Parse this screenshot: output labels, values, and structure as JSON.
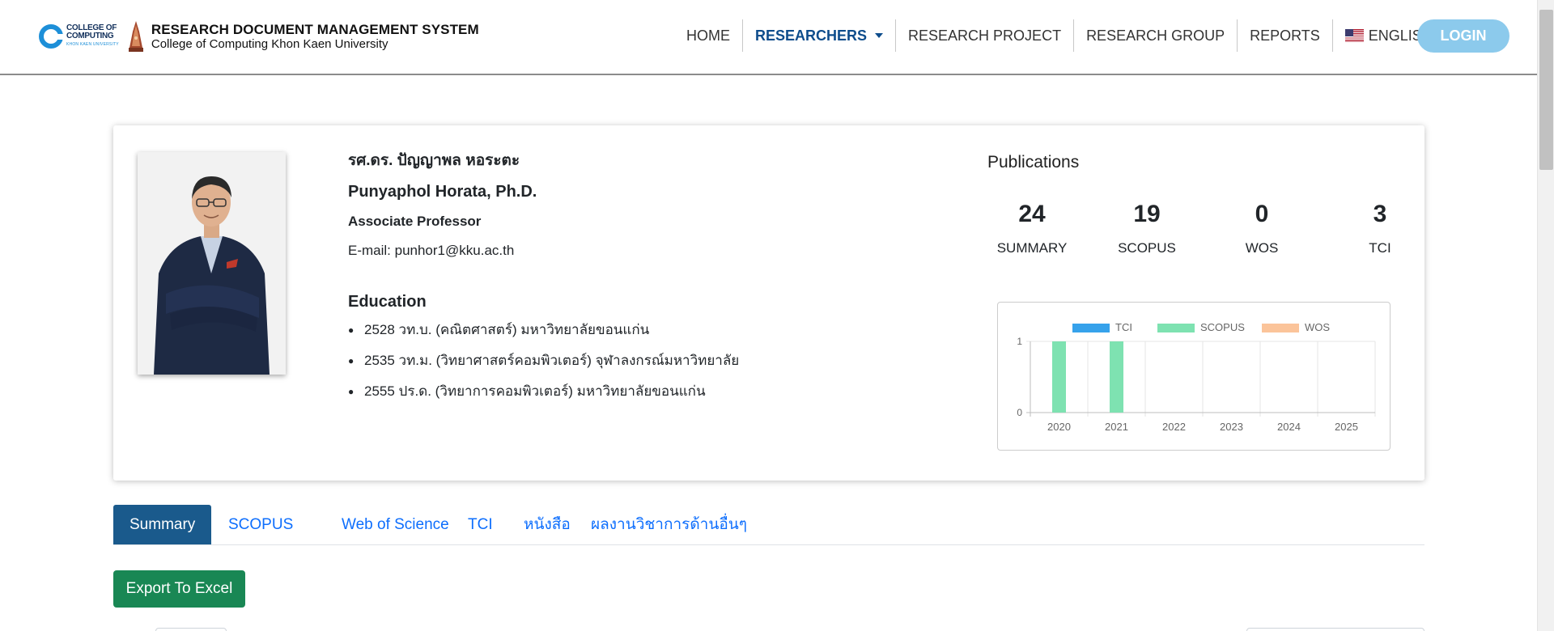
{
  "brand": {
    "logo_line1": "COLLEGE OF",
    "logo_line2": "COMPUTING",
    "logo_line3": "KHON KAEN UNIVERSITY",
    "title": "RESEARCH DOCUMENT MANAGEMENT SYSTEM",
    "subtitle": "College of Computing Khon Kaen University"
  },
  "nav": {
    "home": "HOME",
    "researchers": "RESEARCHERS",
    "research_project": "RESEARCH PROJECT",
    "research_group": "RESEARCH GROUP",
    "reports": "REPORTS",
    "language": "ENGLISH",
    "login": "LOGIN"
  },
  "profile": {
    "name_th": "รศ.ดร. ปัญญาพล หอระตะ",
    "name_en": "Punyaphol Horata, Ph.D.",
    "position": "Associate Professor",
    "email": "E-mail: punhor1@kku.ac.th",
    "education_title": "Education",
    "education": [
      "2528 วท.บ. (คณิตศาสตร์) มหาวิทยาลัยขอนแก่น",
      "2535 วท.ม. (วิทยาศาสตร์คอมพิวเตอร์) จุฬาลงกรณ์มหาวิทยาลัย",
      "2555 ปร.ด. (วิทยาการคอมพิวเตอร์) มหาวิทยาลัยขอนแก่น"
    ]
  },
  "publications": {
    "title": "Publications",
    "stats": [
      {
        "value": "24",
        "label": "SUMMARY"
      },
      {
        "value": "19",
        "label": "SCOPUS"
      },
      {
        "value": "0",
        "label": "WOS"
      },
      {
        "value": "3",
        "label": "TCI"
      }
    ]
  },
  "chart_data": {
    "type": "bar",
    "categories": [
      "2020",
      "2021",
      "2022",
      "2023",
      "2024",
      "2025"
    ],
    "series": [
      {
        "name": "TCI",
        "color": "#36a2eb",
        "values": [
          0,
          0,
          0,
          0,
          0,
          0
        ]
      },
      {
        "name": "SCOPUS",
        "color": "#7ee2b1",
        "values": [
          1,
          1,
          0,
          0,
          0,
          0
        ]
      },
      {
        "name": "WOS",
        "color": "#fbc49a",
        "values": [
          0,
          0,
          0,
          0,
          0,
          0
        ]
      }
    ],
    "ylim": [
      0,
      1
    ],
    "yticks": [
      "0",
      "1"
    ],
    "legend": "top",
    "grid": true
  },
  "tabs": [
    "Summary",
    "SCOPUS",
    "Web of Science",
    "TCI",
    "หนังสือ",
    "ผลงานวิชาการด้านอื่นๆ"
  ],
  "export_label": "Export To Excel"
}
